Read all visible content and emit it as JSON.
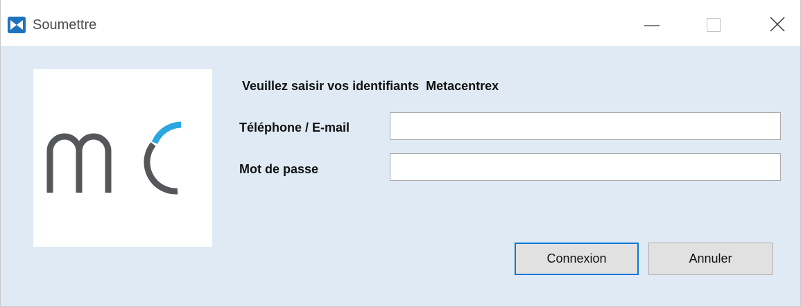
{
  "window": {
    "title": "Soumettre",
    "app_icon": "metacentrex-app-icon",
    "controls": [
      "minimize-icon",
      "maximize-icon",
      "close-icon"
    ]
  },
  "form": {
    "heading": "Veuillez saisir vos identifiants  Metacentrex",
    "phone_label": "Téléphone / E-mail",
    "phone_value": "",
    "password_label": "Mot de passe",
    "password_value": ""
  },
  "buttons": {
    "connect_label": "Connexion",
    "cancel_label": "Annuler"
  },
  "colors": {
    "client_background": "#dfeaf4",
    "logo_gray": "#55575a",
    "logo_blue": "#2aa7e0",
    "focus_border": "#0078d7"
  }
}
